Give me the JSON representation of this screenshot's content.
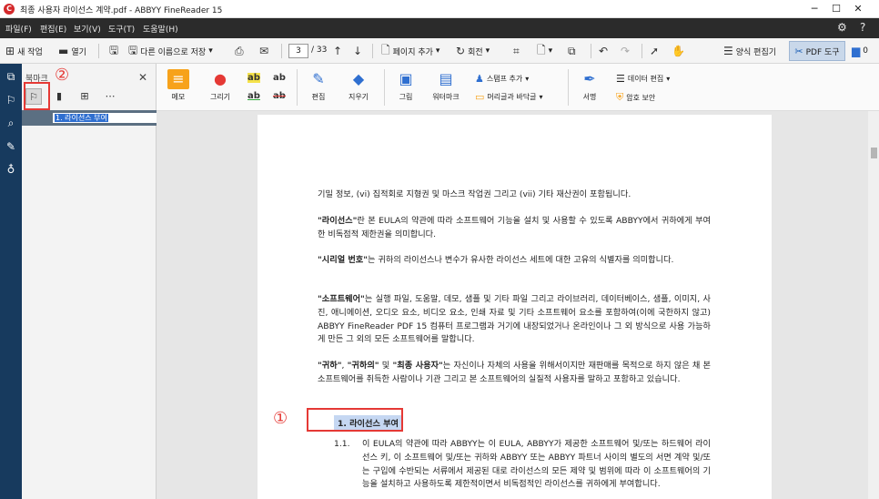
{
  "window": {
    "title": "최종 사용자 라이선스 계약.pdf - ABBYY FineReader 15",
    "app_icon": "abbyy-logo-icon",
    "minimize": "─",
    "maximize": "☐",
    "close": "✕"
  },
  "menu": {
    "items": [
      "파일(F)",
      "편집(E)",
      "보기(V)",
      "도구(T)",
      "도움말(H)"
    ],
    "settings_icon": "⚙",
    "help_icon": "?"
  },
  "toolbar": {
    "new_task": "새 작업",
    "open": "열기",
    "save_as": "다른 이름으로 저장",
    "current_page": "3",
    "page_total": "/ 33",
    "add_page": "페이지 추가",
    "rotate": "회전",
    "edit_form": "양식 편집기",
    "pdf_tool": "PDF 도구",
    "comment_count": "0"
  },
  "bookmark_panel": {
    "title": "북마크",
    "items": [
      {
        "label": "1. 라이선스 부여"
      }
    ]
  },
  "ribbon": {
    "memo": "메모",
    "draw": "그리기",
    "edit": "편집",
    "erase": "지우기",
    "picture": "그림",
    "watermark": "워터마크",
    "stamp_add": "스탬프 추가",
    "header_footer": "머리글과 바닥글",
    "signature": "서명",
    "data_edit": "데이터 편집",
    "password_protect": "암호 보안",
    "ab_label": "ab"
  },
  "annotations": {
    "marker_1": "①",
    "marker_2": "②"
  },
  "document": {
    "p1": "기밀 정보, (vi) 집적회로 지형권 및 마스크 작업권 그리고 (vii) 기타 재산권이 포함됩니다.",
    "p2_term": "\"라이선스\"",
    "p2": "란 본 EULA의 약관에 따라 소프트웨어 기능을 설치 및 사용할 수 있도록 ABBYY에서 귀하에게 부여한 비독점적 제한권을 의미합니다.",
    "p3_term": "\"시리얼 번호\"",
    "p3": "는 귀하의 라이선스나 변수가 유사한 라이선스 세트에 대한 고유의 식별자를 의미합니다.",
    "p4_term": "\"소프트웨어\"",
    "p4": "는 실행 파일, 도움말, 데모, 샘플 및 기타 파일 그리고 라이브러리, 데이터베이스, 샘플, 이미지, 사진, 애니메이션, 오디오 요소, 비디오 요소, 인쇄 자료 및 기타 소프트웨어 요소를 포함하여(이에 국한하지 않고) ABBYY FineReader PDF 15 컴퓨터 프로그램과 거기에 내장되었거나 온라인이나 그 외 방식으로 사용 가능하게 만든 그 외의 모든 소프트웨어를 말합니다.",
    "p5_term1": "\"귀하\"",
    "p5_mid": ", ",
    "p5_term2": "\"귀하의\"",
    "p5_and": " 및 ",
    "p5_term3": "\"최종 사용자\"",
    "p5": "는 자신이나 자체의 사용을 위해서이지만 재판매를 목적으로 하지 않은 채 본 소프트웨어를 취득한 사람이나 기관 그리고 본 소프트웨어의 실질적 사용자를 말하고 포함하고 있습니다.",
    "heading": "1.   라이선스 부여",
    "sub_num": "1.1.",
    "sub_para": "이 EULA의 약관에 따라 ABBYY는 이 EULA, ABBYY가 제공한 소프트웨어 및/또는 하드웨어 라이선스 키, 이 소프트웨어 및/또는 귀하와 ABBYY 또는 ABBYY 파트너 사이의 별도의 서면 계약 및/또는 구입에 수반되는 서류에서 제공된 대로 라이선스의 모든 제약 및 범위에 따라 이 소프트웨어의 기능을 설치하고 사용하도록 제한적이면서 비독점적인 라이선스를 귀하에게 부여합니다."
  }
}
